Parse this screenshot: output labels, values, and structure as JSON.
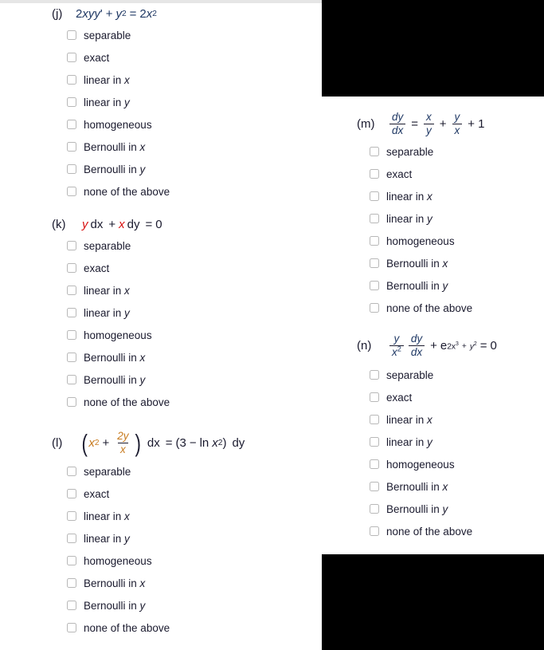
{
  "meta": {
    "page_background": "#ffffff",
    "text_color": "#1a1a2e",
    "accent_red": "#d81010",
    "accent_orange": "#c77a1e",
    "mask_color": "#000000",
    "rule_color": "#e6e6e6"
  },
  "option_set": [
    "separable",
    "exact",
    "linear in x",
    "linear in y",
    "homogeneous",
    "Bernoulli in x",
    "Bernoulli in y",
    "none of the above"
  ],
  "problems": [
    {
      "id": "j",
      "label": "(j)",
      "equation_text": "2xyy' + y^2 = 2x^2",
      "column": "left",
      "options": [
        "separable",
        "exact",
        "linear in x",
        "linear in y",
        "homogeneous",
        "Bernoulli in x",
        "Bernoulli in y",
        "none of the above"
      ]
    },
    {
      "id": "k",
      "label": "(k)",
      "equation_text": "y dx + x dy = 0",
      "column": "left",
      "options": [
        "separable",
        "exact",
        "linear in x",
        "linear in y",
        "homogeneous",
        "Bernoulli in x",
        "Bernoulli in y",
        "none of the above"
      ]
    },
    {
      "id": "l",
      "label": "(l)",
      "equation_text": "(x^2 + 2y/x) dx = (3 - ln x^2) dy",
      "column": "left",
      "options": [
        "separable",
        "exact",
        "linear in x",
        "linear in y",
        "homogeneous",
        "Bernoulli in x",
        "Bernoulli in y",
        "none of the above"
      ]
    },
    {
      "id": "m",
      "label": "(m)",
      "equation_text": "dy/dx = x/y + y/x + 1",
      "column": "right",
      "options": [
        "separable",
        "exact",
        "linear in x",
        "linear in y",
        "homogeneous",
        "Bernoulli in x",
        "Bernoulli in y",
        "none of the above"
      ]
    },
    {
      "id": "n",
      "label": "(n)",
      "equation_text": "(y/x^2) dy/dx + e^(2x^3 + y^2) = 0",
      "column": "right",
      "options": [
        "separable",
        "exact",
        "linear in x",
        "linear in y",
        "homogeneous",
        "Bernoulli in x",
        "Bernoulli in y",
        "none of the above"
      ]
    }
  ],
  "math_atoms": {
    "j": {
      "a1": "2",
      "a2": "xyy",
      "a3": "'",
      "a4": "+",
      "a5": "y",
      "a6": "2",
      "a7": "=",
      "a8": "2",
      "a9": "x",
      "a10": "2"
    },
    "k": {
      "a1": "y",
      "a2": "dx",
      "a3": "+",
      "a4": "x",
      "a5": "dy",
      "a6": "=",
      "a7": "0"
    },
    "l": {
      "a1": "x",
      "a2": "2",
      "a3": "+",
      "a4": "2y",
      "a5": "x",
      "a6": "dx",
      "a7": "=",
      "a8": "(3",
      "a9": "−",
      "a10": "ln",
      "a11": "x",
      "a12": "2",
      "a13": ")",
      "a14": "dy"
    },
    "m": {
      "a1": "dy",
      "a2": "dx",
      "a3": "=",
      "a4": "x",
      "a5": "y",
      "a6": "+",
      "a7": "y",
      "a8": "x",
      "a9": "+",
      "a10": "1"
    },
    "n": {
      "a1": "y",
      "a2": "x",
      "a3": "2",
      "a4": "dy",
      "a5": "dx",
      "a6": "+",
      "a7": "e",
      "a8": "2x",
      "a9": "3",
      "a10": "+",
      "a11": "y",
      "a12": "2",
      "a13": "=",
      "a14": "0"
    }
  }
}
